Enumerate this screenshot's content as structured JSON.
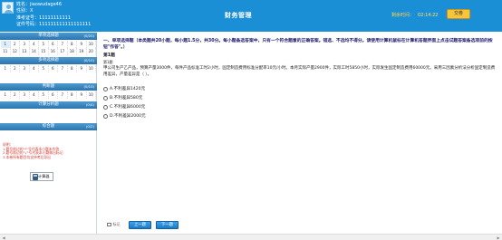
{
  "header": {
    "name_label": "姓名：",
    "name_value": "jiaowudage46",
    "sex_label": "性别：",
    "sex_value": "X",
    "ticket_label": "准考证号：",
    "ticket_value": "11111111111",
    "id_label": "证件号码：",
    "id_value": "111111111111111111",
    "title": "财务管理",
    "timer_label": "剩余时间：",
    "timer_value": "02:14:22",
    "submit_label": "交卷"
  },
  "sidebar": {
    "sections": [
      {
        "title": "单项选择题",
        "count": "(0/20)"
      },
      {
        "title": "多项选择题",
        "count": "(0/10)"
      },
      {
        "title": "判断题",
        "count": "(0/10)"
      },
      {
        "title": "计算分析题",
        "count": "(0/4)"
      },
      {
        "title": "综合题",
        "count": "(0/2)"
      }
    ],
    "grid_numbers": [
      "1",
      "2",
      "3",
      "4",
      "5",
      "6",
      "7",
      "8",
      "9",
      "10",
      "11",
      "12",
      "13",
      "14",
      "15",
      "16",
      "17",
      "18",
      "19",
      "20",
      "1",
      "2",
      "3",
      "4",
      "5",
      "6",
      "7",
      "8",
      "9",
      "10",
      "1",
      "2",
      "3",
      "4",
      "5",
      "6",
      "7",
      "8",
      "9",
      "10"
    ],
    "current": "1",
    "notes_title": "说明：",
    "notes": [
      "1.题号前边的\"*\"号代表本小题未作答",
      "2.题号前边的\"√\"号代表本小题做出标记",
      "3.本卷所有题目均支持考后导出"
    ],
    "calc_label": "计算器"
  },
  "question": {
    "instructions": "一、单项选择题（本类题共20小题，每小题1.5分，共30分。每小题备选答案中，只有一个符合题意的正确答案。错选、不选均不得分。请使用计算机鼠标在计算机答题界面上点击试题答案备选项前的按钮\"作答\"。）",
    "number": "第1题",
    "score": "第1题",
    "text": "甲公司生产乙产品，预算产量3000件，每件产品标准工时2小时，固定制造费用标准分配率10元/小时。本月实际产量2900件，实际工时5850小时，实际发生固定制造费用60000元。采用三因素分析法分析固定制造费用差异，产量差异是（ ）。",
    "options": [
      {
        "letter": "A.",
        "text": "不利差异1420元"
      },
      {
        "letter": "B.",
        "text": "不利差异580元"
      },
      {
        "letter": "C.",
        "text": "不利差异6000元"
      },
      {
        "letter": "D.",
        "text": "不利差异2000元"
      }
    ],
    "mark_label": "标记",
    "prev_label": "上一题",
    "next_label": "下一题"
  }
}
